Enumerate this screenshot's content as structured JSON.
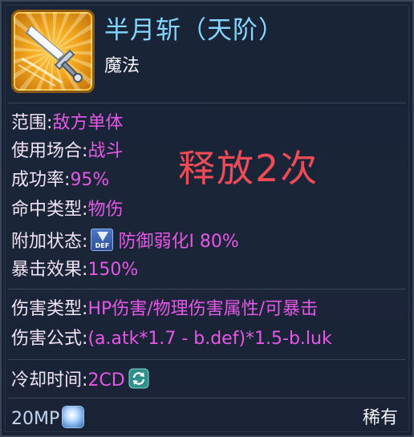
{
  "skill": {
    "name": "半月斩（天阶）",
    "type": "魔法",
    "icon": "sword-slash-icon"
  },
  "stats": {
    "range": {
      "label": "范围",
      "value": "敌方单体"
    },
    "occasion": {
      "label": "使用场合",
      "value": "战斗"
    },
    "success_rate": {
      "label": "成功率",
      "value": "95%"
    },
    "hit_type": {
      "label": "命中类型",
      "value": "物伤"
    },
    "extra_state": {
      "label": "附加状态",
      "value": "防御弱化I 80%",
      "icon": "def-down-icon"
    },
    "crit_effect": {
      "label": "暴击效果",
      "value": "150%"
    }
  },
  "damage": {
    "type": {
      "label": "伤害类型",
      "value": "HP伤害/物理伤害属性/可暴击"
    },
    "formula": {
      "label": "伤害公式",
      "value": "(a.atk*1.7 - b.def)*1.5-b.luk"
    }
  },
  "cooldown": {
    "label": "冷却时间",
    "value": "2CD",
    "icon": "refresh-icon"
  },
  "cost": {
    "value": "20MP",
    "icon": "mp-orb-icon"
  },
  "rarity": "稀有",
  "annotation": "释放2次",
  "colors": {
    "title": "#84d6ff",
    "label": "#f0e4f4",
    "value": "#e657e8",
    "annotation": "#ee4b57",
    "background": "#1b2538"
  }
}
